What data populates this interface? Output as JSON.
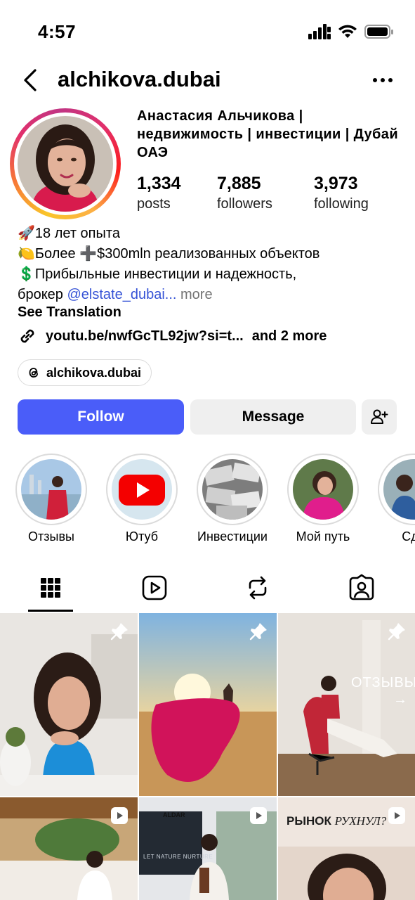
{
  "status_bar": {
    "time": "4:57"
  },
  "header": {
    "username": "alchikova.dubai"
  },
  "profile": {
    "full_name": "Анастасия Альчикова | недвижимость | инвестиции | Дубай ОАЭ",
    "stats": [
      {
        "num": "1,334",
        "label": "posts"
      },
      {
        "num": "7,885",
        "label": "followers"
      },
      {
        "num": "3,973",
        "label": "following"
      }
    ],
    "bio": {
      "line1": "🚀18 лет опыта",
      "line2": "🍋Более ➕$300mln реализованных объектов",
      "line3": "💲Прибыльные инвестиции и надежность,",
      "line4_prefix": "брокер ",
      "mention": "@elstate_dubai",
      "ellipsis": "...",
      "more": " more"
    },
    "see_translation": "See Translation",
    "link": "youtu.be/nwfGcTL92jw?si=t...",
    "link_more": "and 2 more",
    "threads": "alchikova.dubai"
  },
  "buttons": {
    "follow": "Follow",
    "message": "Message"
  },
  "highlights": [
    {
      "label": "Отзывы"
    },
    {
      "label": "Ютуб"
    },
    {
      "label": "Инвестиции"
    },
    {
      "label": "Мой путь"
    },
    {
      "label": "Сде"
    }
  ],
  "grid": {
    "post3_overlay": "ОТЗЫВЫ",
    "post3_arrow": "→",
    "post6_text_a": "РЫНОК ",
    "post6_text_b": "РУХНУЛ?",
    "post5_logo": "ALDAR",
    "post5_banner": "LET NATURE NURTURE"
  }
}
